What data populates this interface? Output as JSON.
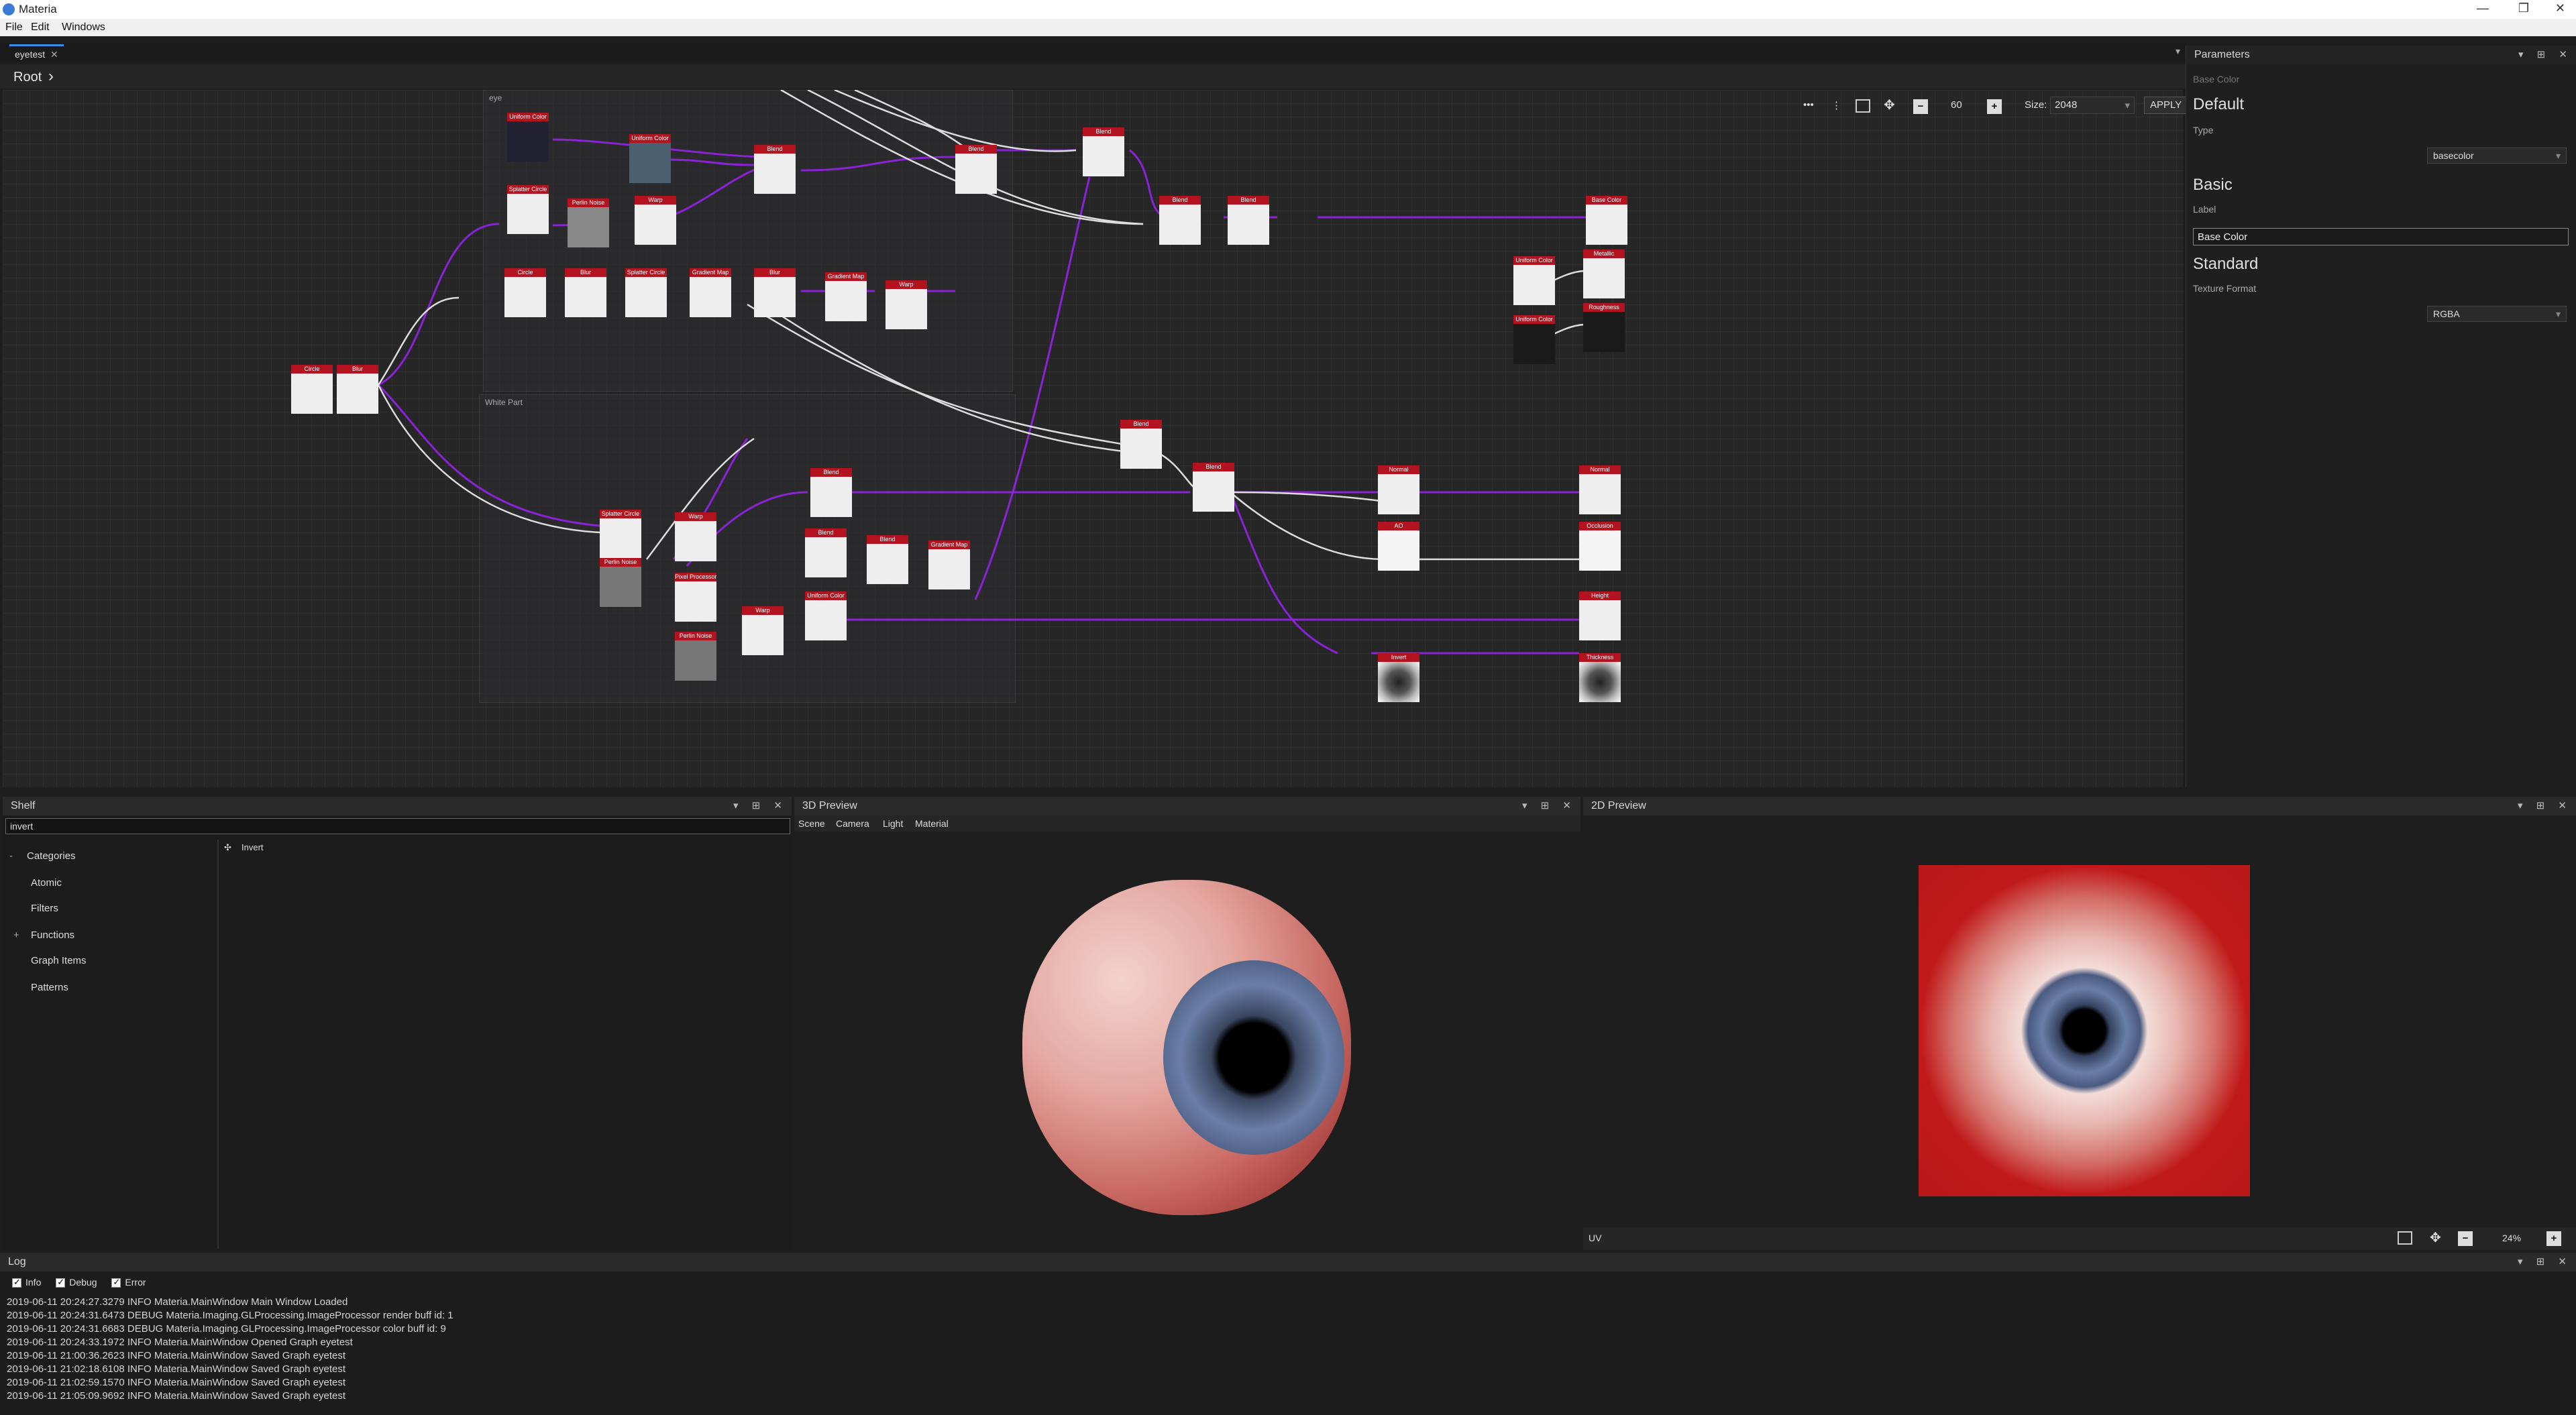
{
  "app": {
    "title": "Materia"
  },
  "menu": [
    "File",
    "Edit",
    "Windows"
  ],
  "document_tab": "eyetest",
  "breadcrumb": "Root",
  "toolbar": {
    "zoom_value": "60",
    "size_label": "Size:",
    "size_value": "2048",
    "apply_label": "APPLY"
  },
  "groups": [
    {
      "label": "eye"
    },
    {
      "label": "White Part"
    }
  ],
  "nodes": [
    {
      "title": "Uniform Color",
      "kind": "darkb"
    },
    {
      "title": "Uniform Color",
      "kind": "darkb"
    },
    {
      "title": "Blend",
      "kind": "ring"
    },
    {
      "title": "Blend",
      "kind": "ring"
    },
    {
      "title": "Blend",
      "kind": "eye"
    },
    {
      "title": "Blend",
      "kind": "eye"
    },
    {
      "title": "Blend",
      "kind": "eye"
    },
    {
      "title": "Base Color",
      "kind": "eye"
    },
    {
      "title": "Splatter Circle",
      "kind": "pattern"
    },
    {
      "title": "Perlin Noise",
      "kind": "pattern"
    },
    {
      "title": "Warp",
      "kind": "ring"
    },
    {
      "title": "Circle",
      "kind": "pattern"
    },
    {
      "title": "Blur",
      "kind": "pattern"
    },
    {
      "title": "Splatter Circle",
      "kind": "ring"
    },
    {
      "title": "Gradient Map",
      "kind": "ring"
    },
    {
      "title": "Blur",
      "kind": "ring"
    },
    {
      "title": "Gradient Map",
      "kind": "ring"
    },
    {
      "title": "Warp",
      "kind": "ring"
    },
    {
      "title": "Circle",
      "kind": "pattern"
    },
    {
      "title": "Blur",
      "kind": "pattern"
    },
    {
      "title": "Uniform Color",
      "kind": "darkb"
    },
    {
      "title": "Metallic",
      "kind": "darkb"
    },
    {
      "title": "Uniform Color",
      "kind": "darkb"
    },
    {
      "title": "Roughness",
      "kind": "darkb"
    },
    {
      "title": "Blend",
      "kind": "ring"
    },
    {
      "title": "Blend",
      "kind": "ring"
    },
    {
      "title": "Normal",
      "kind": "blueb"
    },
    {
      "title": "Normal",
      "kind": "blueb"
    },
    {
      "title": "AO",
      "kind": "pattern"
    },
    {
      "title": "Occlusion",
      "kind": "pattern"
    },
    {
      "title": "Splatter Circle",
      "kind": "pattern"
    },
    {
      "title": "Perlin Noise",
      "kind": "pattern"
    },
    {
      "title": "Warp",
      "kind": "pattern"
    },
    {
      "title": "Blend",
      "kind": "sphere"
    },
    {
      "title": "Blend",
      "kind": "sphere"
    },
    {
      "title": "Blend",
      "kind": "sphere"
    },
    {
      "title": "Gradient Map",
      "kind": "redb"
    },
    {
      "title": "Uniform Color",
      "kind": "darkb"
    },
    {
      "title": "Height",
      "kind": "darkb"
    },
    {
      "title": "Pixel Processor",
      "kind": "sphere"
    },
    {
      "title": "Perlin Noise",
      "kind": "pattern"
    },
    {
      "title": "Warp",
      "kind": "sphere"
    },
    {
      "title": "Invert",
      "kind": "ring"
    },
    {
      "title": "Thickness",
      "kind": "ring"
    }
  ],
  "parameters": {
    "header": "Parameters",
    "node_name": "Base Color",
    "sections": {
      "default": "Default",
      "type_label": "Type",
      "type_value": "basecolor",
      "basic": "Basic",
      "label_label": "Label",
      "label_value": "Base Color",
      "standard": "Standard",
      "format_label": "Texture Format",
      "format_value": "RGBA"
    }
  },
  "shelf": {
    "header": "Shelf",
    "search_value": "invert",
    "categories_label": "Categories",
    "items": [
      "Atomic",
      "Filters",
      "Functions",
      "Graph Items",
      "Patterns"
    ],
    "result": "Invert"
  },
  "preview3d": {
    "header": "3D Preview",
    "tabs": [
      "Scene",
      "Camera",
      "Light",
      "Material"
    ]
  },
  "preview2d": {
    "header": "2D Preview",
    "uv_label": "UV",
    "zoom": "24%"
  },
  "log": {
    "header": "Log",
    "filters": [
      "Info",
      "Debug",
      "Error"
    ],
    "lines": [
      "2019-06-11 20:24:27.3279 INFO Materia.MainWindow Main Window Loaded",
      "2019-06-11 20:24:31.6473 DEBUG Materia.Imaging.GLProcessing.ImageProcessor render buff id: 1",
      "2019-06-11 20:24:31.6683 DEBUG Materia.Imaging.GLProcessing.ImageProcessor color buff id: 9",
      "2019-06-11 20:24:33.1972 INFO Materia.MainWindow Opened Graph eyetest",
      "2019-06-11 21:00:36.2623 INFO Materia.MainWindow Saved Graph eyetest",
      "2019-06-11 21:02:18.6108 INFO Materia.MainWindow Saved Graph eyetest",
      "2019-06-11 21:02:59.1570 INFO Materia.MainWindow Saved Graph eyetest",
      "2019-06-11 21:05:09.9692 INFO Materia.MainWindow Saved Graph eyetest"
    ]
  },
  "colors": {
    "accent": "#b3121f",
    "wire_purple": "#8a22d6",
    "wire_white": "#dddddd",
    "tab_underline": "#3a8ee6"
  }
}
